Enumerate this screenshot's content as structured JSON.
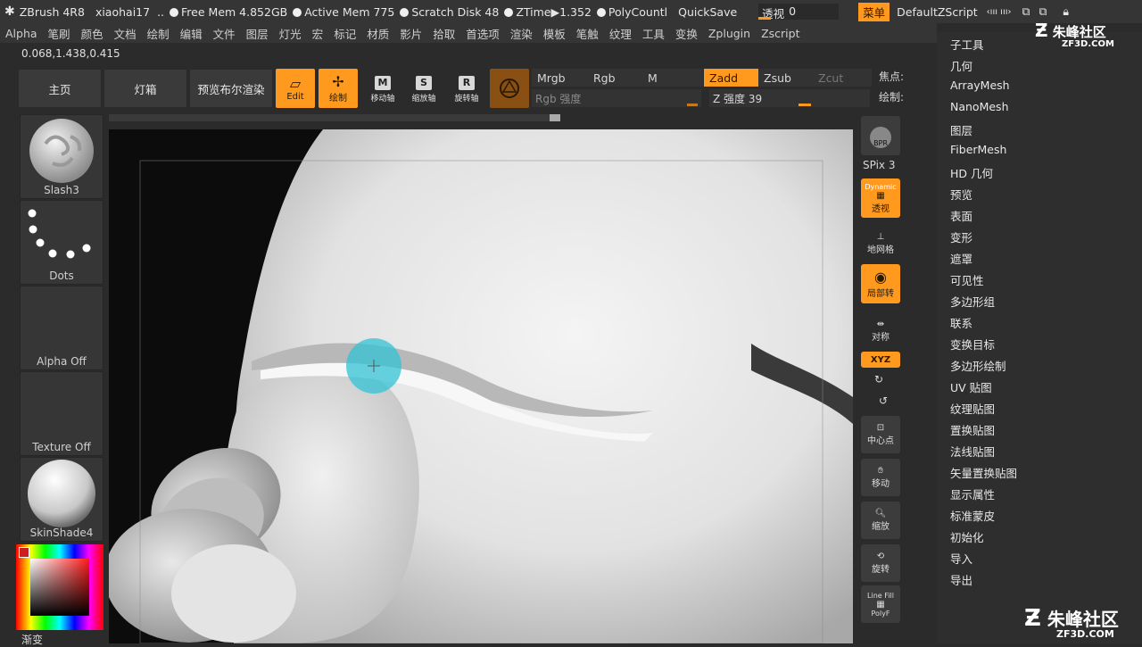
{
  "titlebar": {
    "app": "ZBrush 4R8",
    "user": "xiaohai17",
    "free_mem": "Free Mem 4.852GB",
    "active_mem": "Active Mem 775",
    "scratch": "Scratch Disk 48",
    "ztime": "ZTime▶1.352",
    "polycount": "PolyCountl",
    "quicksave": "QuickSave",
    "transparency_label": "透视",
    "transparency_value": "0",
    "menu_btn": "菜单",
    "script": "DefaultZScript"
  },
  "menubar": [
    "Alpha",
    "笔刷",
    "颜色",
    "文档",
    "绘制",
    "编辑",
    "文件",
    "图层",
    "灯光",
    "宏",
    "标记",
    "材质",
    "影片",
    "拾取",
    "首选项",
    "渲染",
    "模板",
    "笔触",
    "纹理",
    "工具",
    "变换",
    "Zplugin",
    "Zscript"
  ],
  "coords": "0.068,1.438,0.415",
  "shelf": {
    "home": "主页",
    "lightbox": "灯箱",
    "bpr_preview": "预览布尔渲染",
    "edit": "Edit",
    "draw": "绘制",
    "move": "移动轴",
    "scale": "缩放轴",
    "rotate": "旋转轴",
    "move_glyph": "M",
    "scale_glyph": "S",
    "rotate_glyph": "R",
    "mrgb": "Mrgb",
    "rgb": "Rgb",
    "m": "M",
    "zadd": "Zadd",
    "zsub": "Zsub",
    "zcut": "Zcut",
    "rgb_intensity": "Rgb 强度",
    "z_intensity": "Z 强度 39",
    "focal": "焦点:",
    "draw_size": "绘制:"
  },
  "left_panel": {
    "brush": "Slash3",
    "stroke": "Dots",
    "alpha": "Alpha Off",
    "texture": "Texture Off",
    "material": "SkinShade4",
    "gradient": "渐变"
  },
  "right_shelf": {
    "bpr": "BPR",
    "spix": "SPix 3",
    "dynamic": "Dynamic",
    "persp": "透视",
    "floor": "地网格",
    "local": "局部转",
    "sym": "对称",
    "xyz": "XYZ",
    "center": "中心点",
    "move": "移动",
    "zoom": "缩放",
    "rotate": "旋转",
    "linefill": "Line Fill",
    "polyf": "PolyF"
  },
  "tool_menu": [
    "子工具",
    "几何",
    "ArrayMesh",
    "NanoMesh",
    "图层",
    "FiberMesh",
    "HD 几何",
    "预览",
    "表面",
    "变形",
    "遮罩",
    "可见性",
    "多边形组",
    "联系",
    "变换目标",
    "多边形绘制",
    "UV 贴图",
    "纹理贴图",
    "置换贴图",
    "法线贴图",
    "矢量置换贴图",
    "显示属性",
    "标准蒙皮",
    "初始化",
    "导入",
    "导出"
  ],
  "watermark": {
    "brand": "朱峰社区",
    "url": "ZF3D.COM"
  },
  "colors": {
    "accent": "#ff9a1f",
    "panel": "#353535",
    "background": "#2b2b2b"
  }
}
